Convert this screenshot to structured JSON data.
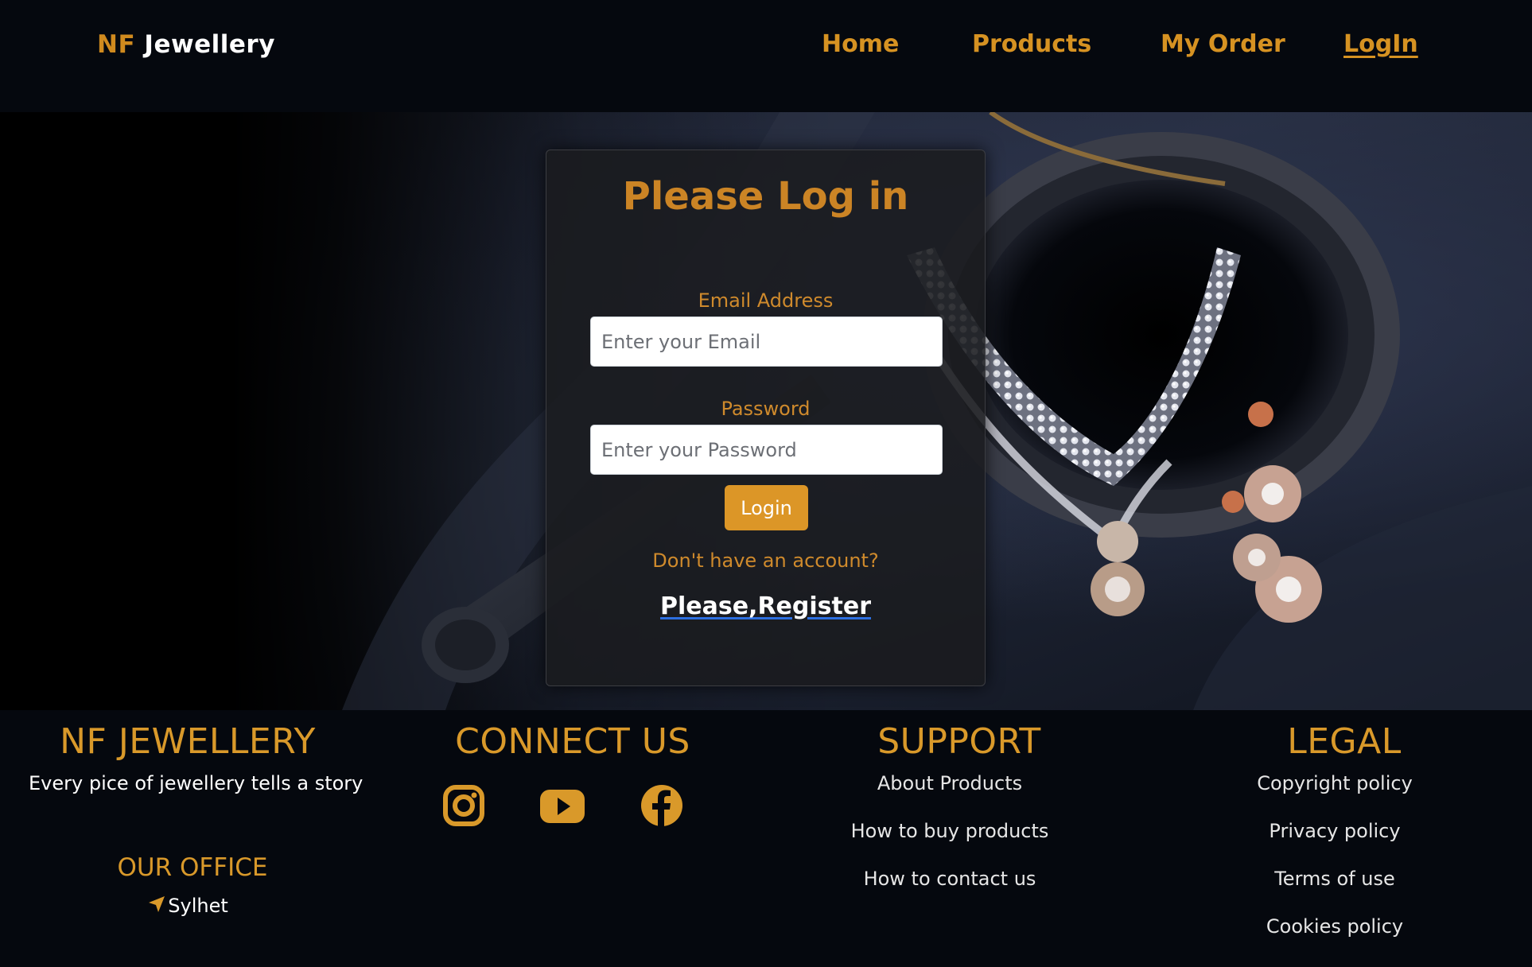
{
  "nav": {
    "brand_prefix": "NF",
    "brand_suffix": " Jewellery",
    "links": [
      "Home",
      "Products",
      "My Order",
      "LogIn"
    ]
  },
  "login": {
    "title": "Please Log in",
    "email_label": "Email Address",
    "email_placeholder": "Enter your Email",
    "password_label": "Password",
    "password_placeholder": "Enter your Password",
    "button": "Login",
    "no_account": "Don't have an account?",
    "register": "Please,Register"
  },
  "footer": {
    "brand": {
      "heading": "NF JEWELLERY",
      "tagline": "Every pice of jewellery tells a story",
      "office_heading": "OUR OFFICE",
      "office_location": "Sylhet"
    },
    "connect": {
      "heading": "CONNECT US",
      "icons": [
        "instagram-icon",
        "youtube-icon",
        "facebook-icon"
      ]
    },
    "support": {
      "heading": "SUPPORT",
      "links": [
        "About Products",
        "How to buy products",
        "How to contact us"
      ]
    },
    "legal": {
      "heading": "LEGAL",
      "links": [
        "Copyright policy",
        "Privacy policy",
        "Terms of use",
        "Cookies policy"
      ]
    }
  },
  "colors": {
    "accent": "#d08a1e",
    "button": "#dc9627",
    "background": "#05080e"
  }
}
